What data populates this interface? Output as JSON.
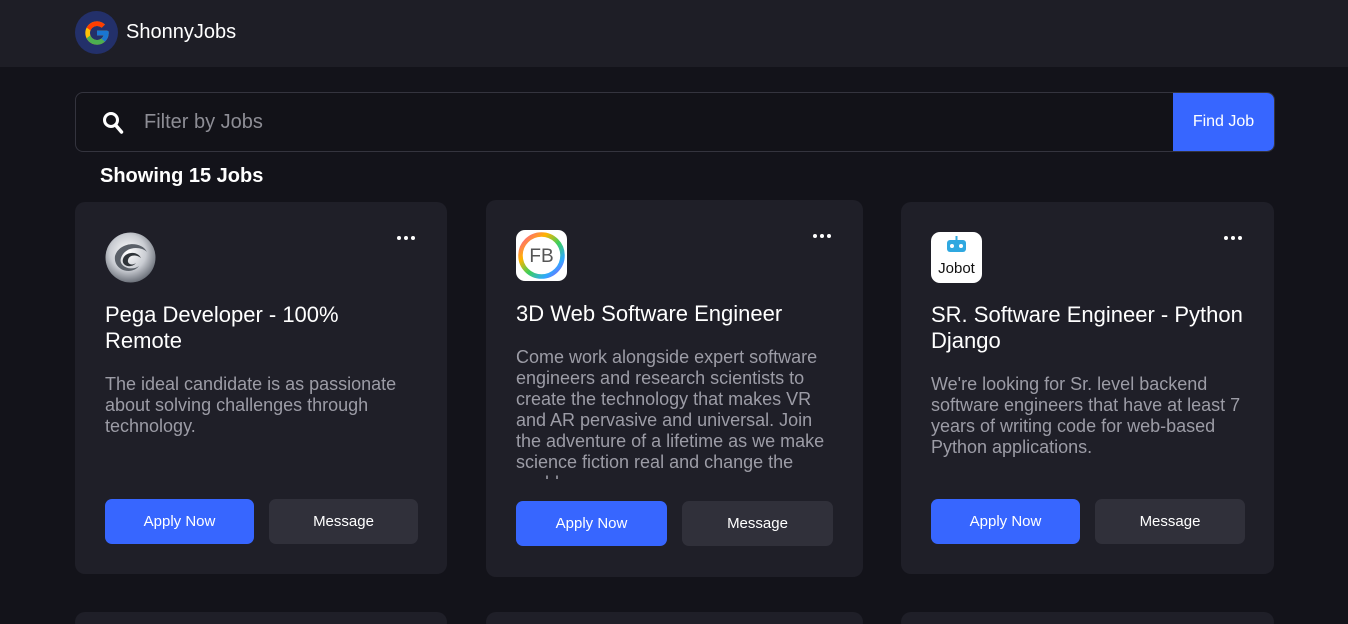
{
  "brand": {
    "name": "ShonnyJobs",
    "logo_icon": "google-g-icon"
  },
  "search": {
    "placeholder": "Filter by Jobs",
    "value": "",
    "button_label": "Find Job",
    "icon": "search-icon"
  },
  "results": {
    "count_label": "Showing 15 Jobs"
  },
  "colors": {
    "accent": "#3766ff",
    "background": "#13131a",
    "card": "#1f1f28",
    "navbar": "#1e1e26"
  },
  "jobs": [
    {
      "logo_icon": "swirl-logo-icon",
      "title": "Pega Developer - 100% Remote",
      "description": "The ideal candidate is as passionate about solving challenges through technology.",
      "apply_label": "Apply Now",
      "message_label": "Message"
    },
    {
      "logo_icon": "fb-logo-icon",
      "logo_text": "FB",
      "title": "3D Web Software Engineer",
      "description": "Come work alongside expert software engineers and research scientists to create the technology that makes VR and AR pervasive and universal. Join the adventure of a lifetime as we make science fiction real and change the world.",
      "apply_label": "Apply Now",
      "message_label": "Message"
    },
    {
      "logo_icon": "jobot-logo-icon",
      "logo_text": "Jobot",
      "title": "SR. Software Engineer - Python Django",
      "description": "We're looking for Sr. level backend software engineers that have at least 7 years of writing code for web-based Python applications.",
      "apply_label": "Apply Now",
      "message_label": "Message"
    }
  ]
}
